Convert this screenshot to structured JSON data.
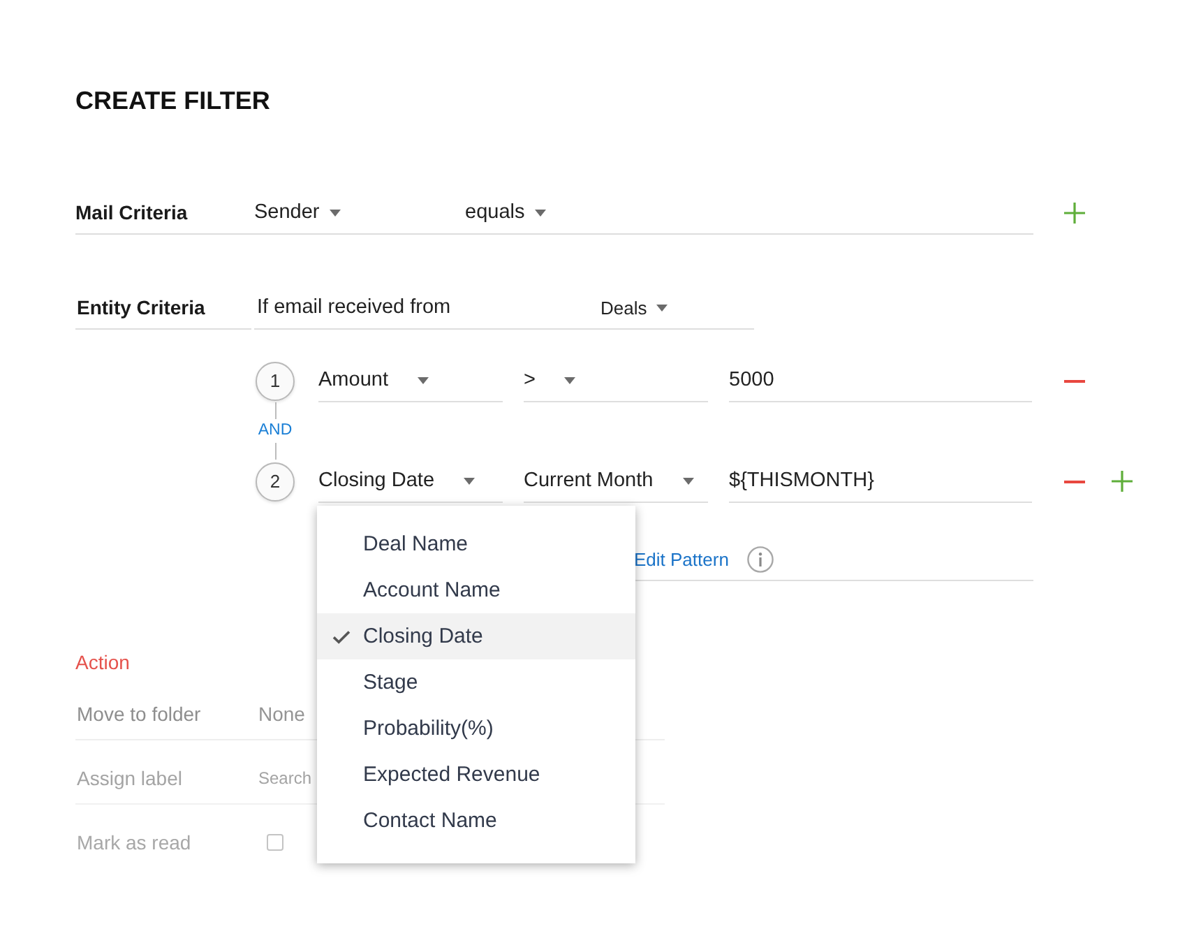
{
  "title": "CREATE FILTER",
  "mail_criteria": {
    "label": "Mail Criteria",
    "field": "Sender",
    "operator": "equals"
  },
  "entity_criteria": {
    "label": "Entity Criteria",
    "prefix": "If email received from",
    "module": "Deals"
  },
  "conditions": {
    "join": "AND",
    "rows": [
      {
        "number": "1",
        "field": "Amount",
        "operator": ">",
        "value": "5000",
        "expanded": false
      },
      {
        "number": "2",
        "field": "Closing Date",
        "operator": "Current Month",
        "value": "${THISMONTH}",
        "expanded": true
      }
    ]
  },
  "pattern": {
    "link": "Edit Pattern"
  },
  "action": {
    "heading": "Action",
    "rows": [
      {
        "kind": "select",
        "label": "Move to folder",
        "value": "None"
      },
      {
        "kind": "search",
        "label": "Assign label",
        "placeholder": "Search"
      },
      {
        "kind": "checkbox",
        "label": "Mark as read",
        "checked": false
      }
    ]
  },
  "field_menu": {
    "items": [
      {
        "label": "Deal Name",
        "selected": false
      },
      {
        "label": "Account Name",
        "selected": false
      },
      {
        "label": "Closing Date",
        "selected": true
      },
      {
        "label": "Stage",
        "selected": false
      },
      {
        "label": "Probability(%)",
        "selected": false
      },
      {
        "label": "Expected Revenue",
        "selected": false
      },
      {
        "label": "Contact Name",
        "selected": false
      }
    ]
  }
}
